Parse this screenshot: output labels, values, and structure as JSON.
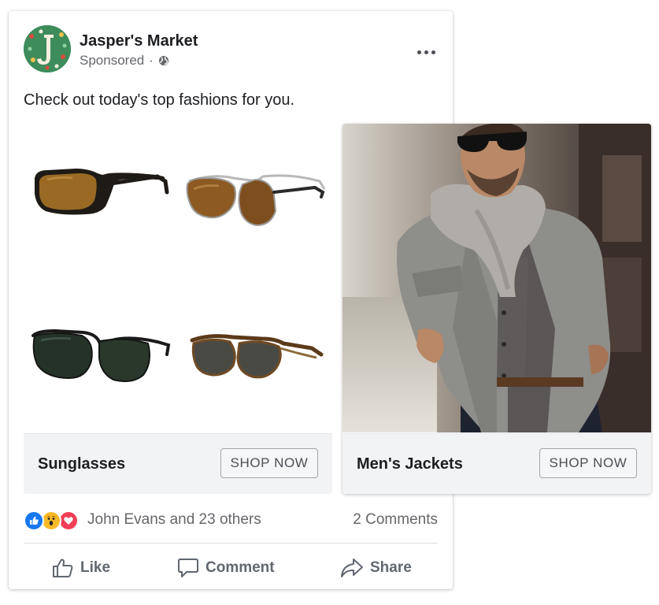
{
  "post": {
    "page_name": "Jasper's Market",
    "sponsored_label": "Sponsored",
    "separator": "·",
    "caption": "Check out today's top fashions for you."
  },
  "carousel": [
    {
      "title": "Sunglasses",
      "cta": "SHOP NOW",
      "image_subject": "four pairs of sunglasses"
    },
    {
      "title": "Men's Jackets",
      "cta": "SHOP NOW",
      "image_subject": "man in grey wool jacket and knit scarf"
    }
  ],
  "engagement": {
    "reactions": [
      "like-icon",
      "wow-icon",
      "love-icon"
    ],
    "reaction_names": "John Evans and 23 others",
    "comments": "2 Comments"
  },
  "actions": {
    "like": "Like",
    "comment": "Comment",
    "share": "Share"
  },
  "colors": {
    "like_blue": "#1877f2",
    "wow_yellow": "#f7b928",
    "love_red": "#f33e58",
    "footer_gray": "#f2f3f5",
    "secondary_text": "#65676b"
  }
}
